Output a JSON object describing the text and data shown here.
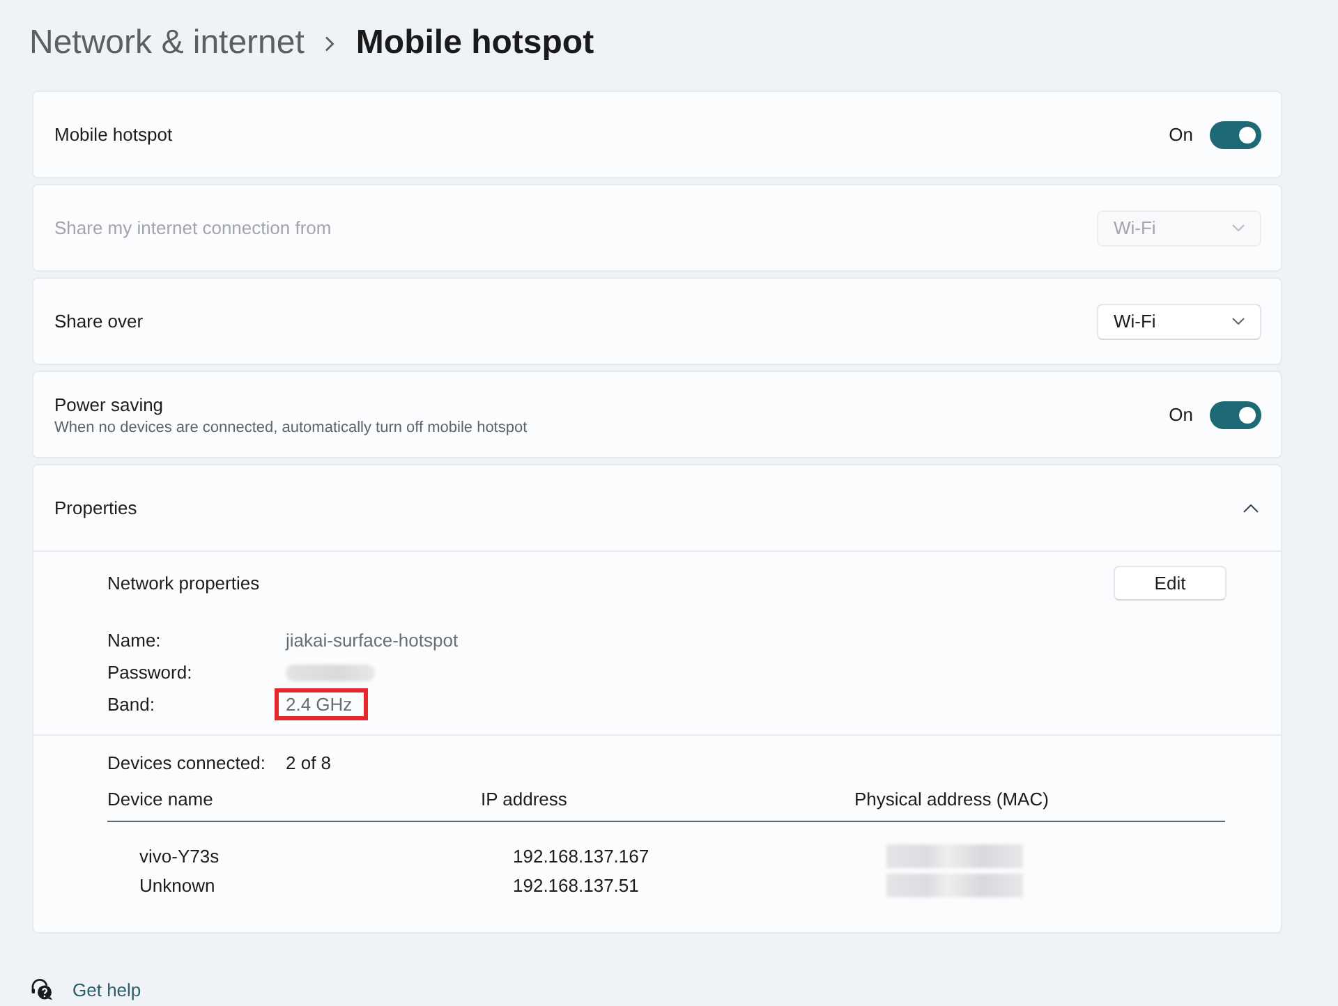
{
  "breadcrumb": [
    {
      "label": "Network & internet",
      "current": false
    },
    {
      "label": "Mobile hotspot",
      "current": true
    }
  ],
  "settings": [
    {
      "kind": "toggle",
      "label": "Mobile hotspot",
      "disabled": false,
      "on": true,
      "state_label": "On"
    },
    {
      "kind": "dropdown",
      "label": "Share my internet connection from",
      "disabled": true,
      "value": "Wi-Fi"
    },
    {
      "kind": "dropdown",
      "label": "Share over",
      "disabled": false,
      "value": "Wi-Fi"
    },
    {
      "kind": "toggle",
      "label": "Power saving",
      "description": "When no devices are connected, automatically turn off mobile hotspot",
      "disabled": false,
      "on": true,
      "state_label": "On"
    }
  ],
  "properties": {
    "label": "Properties",
    "expanded": true,
    "network": {
      "title": "Network properties",
      "edit_button": "Edit",
      "fields": [
        {
          "label": "Name:",
          "kind": "text",
          "value": "jiakai-surface-hotspot",
          "highlighted": false
        },
        {
          "label": "Password:",
          "kind": "redacted",
          "highlighted": false
        },
        {
          "label": "Band:",
          "kind": "text",
          "value": "2.4 GHz",
          "highlighted": true
        }
      ]
    },
    "devices": {
      "label": "Devices connected:",
      "count": "2 of 8",
      "columns": [
        "Device name",
        "IP address",
        "Physical address (MAC)"
      ],
      "rows": [
        {
          "name": "vivo-Y73s",
          "ip": "192.168.137.167"
        },
        {
          "name": "Unknown",
          "ip": "192.168.137.51"
        }
      ]
    }
  },
  "help_link": "Get help"
}
